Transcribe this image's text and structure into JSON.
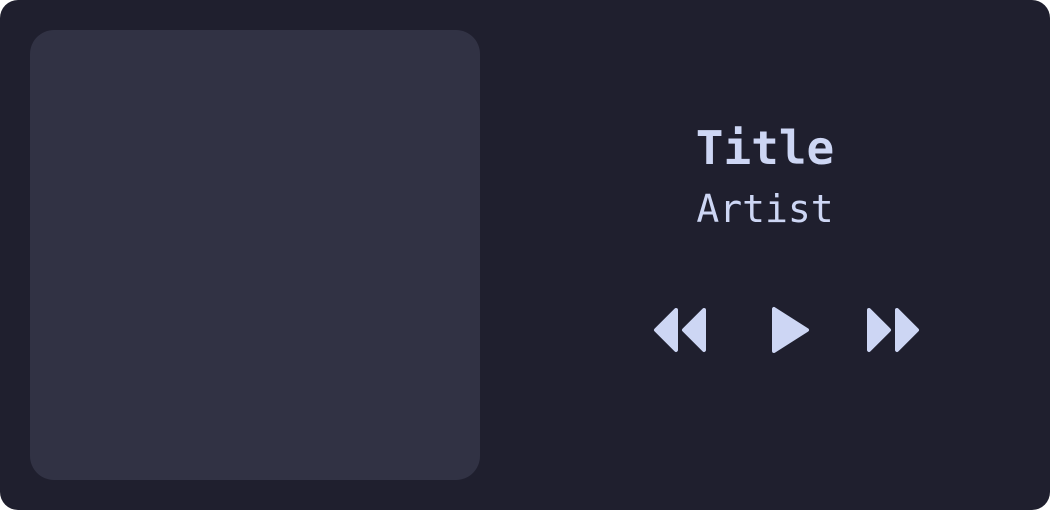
{
  "track": {
    "title": "Title",
    "artist": "Artist"
  },
  "controls": {
    "previous_icon": "rewind-icon",
    "play_icon": "play-icon",
    "next_icon": "fast-forward-icon"
  },
  "colors": {
    "background": "#1f1f2e",
    "cover": "#313244",
    "foreground": "#cdd6f4"
  }
}
